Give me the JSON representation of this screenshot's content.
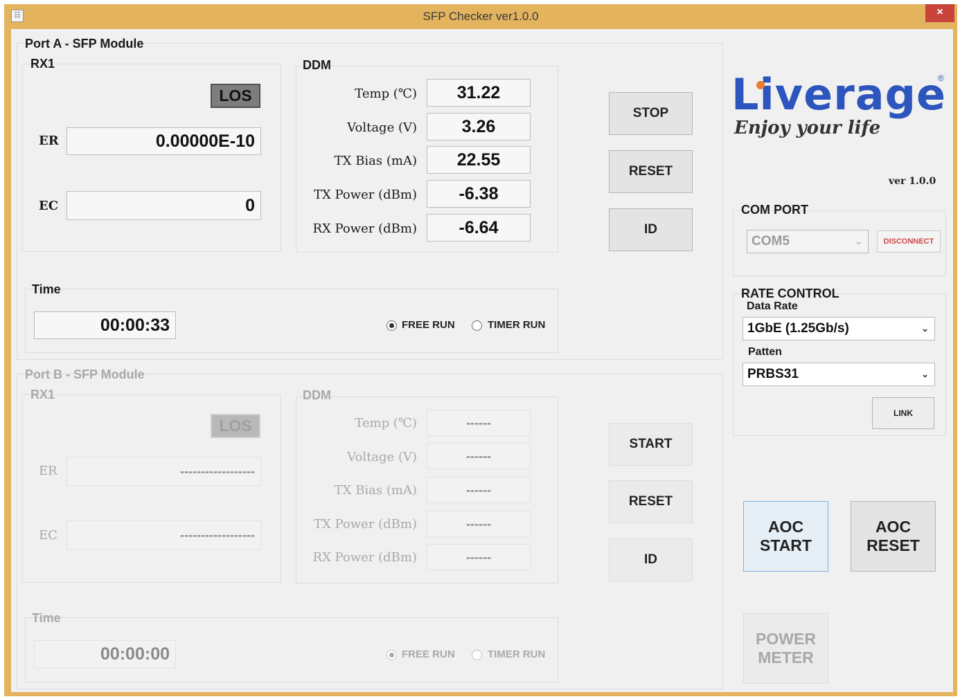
{
  "window": {
    "title": "SFP Checker ver1.0.0",
    "close_glyph": "×"
  },
  "port_a": {
    "title": "Port A - SFP Module",
    "rx_title": "RX1",
    "los_label": "LOS",
    "er_label": "ER",
    "er_value": "0.00000E-10",
    "ec_label": "EC",
    "ec_value": "0",
    "ddm_title": "DDM",
    "ddm": [
      {
        "label": "Temp (℃)",
        "value": "31.22"
      },
      {
        "label": "Voltage (V)",
        "value": "3.26"
      },
      {
        "label": "TX Bias (mA)",
        "value": "22.55"
      },
      {
        "label": "TX Power (dBm)",
        "value": "-6.38"
      },
      {
        "label": "RX Power (dBm)",
        "value": "-6.64"
      }
    ],
    "buttons": {
      "stop": "STOP",
      "reset": "RESET",
      "id": "ID"
    },
    "time_title": "Time",
    "time_value": "00:00:33",
    "free_run": "FREE RUN",
    "timer_run": "TIMER RUN",
    "free_run_selected": true
  },
  "port_b": {
    "title": "Port B - SFP Module",
    "rx_title": "RX1",
    "los_label": "LOS",
    "er_label": "ER",
    "er_value": "------------------",
    "ec_label": "EC",
    "ec_value": "------------------",
    "ddm_title": "DDM",
    "ddm": [
      {
        "label": "Temp (℃)",
        "value": "------"
      },
      {
        "label": "Voltage (V)",
        "value": "------"
      },
      {
        "label": "TX Bias (mA)",
        "value": "------"
      },
      {
        "label": "TX Power (dBm)",
        "value": "------"
      },
      {
        "label": "RX Power (dBm)",
        "value": "------"
      }
    ],
    "buttons": {
      "start": "START",
      "reset": "RESET",
      "id": "ID"
    },
    "time_title": "Time",
    "time_value": "00:00:00",
    "free_run": "FREE RUN",
    "timer_run": "TIMER RUN",
    "free_run_selected": true
  },
  "logo": {
    "brand": "Liverage",
    "registered": "®",
    "tagline": "Enjoy your life",
    "version": "ver 1.0.0",
    "brand_color": "#2c55bd",
    "accent_color": "#e97b2a"
  },
  "com_port": {
    "title": "COM PORT",
    "selected": "COM5",
    "disconnect_label": "DISCONNECT"
  },
  "rate_control": {
    "title": "RATE CONTROL",
    "data_rate_label": "Data Rate",
    "data_rate_value": "1GbE (1.25Gb/s)",
    "patten_label": "Patten",
    "patten_value": "PRBS31",
    "link_label": "LINK"
  },
  "aoc": {
    "start_line1": "AOC",
    "start_line2": "START",
    "reset_line1": "AOC",
    "reset_line2": "RESET"
  },
  "power_meter": {
    "line1": "POWER",
    "line2": "METER"
  }
}
